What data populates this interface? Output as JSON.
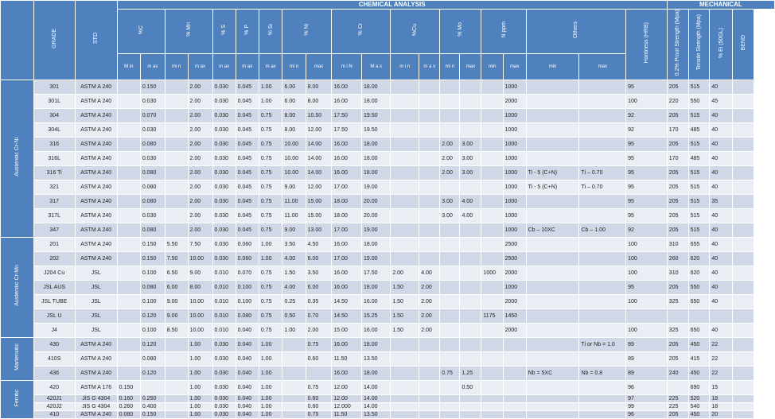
{
  "groups": {
    "chemical": "CHEMICAL ANALYSIS",
    "mechanical": "MECHANICAL"
  },
  "headers": {
    "grade": "GRADE",
    "std": "STD",
    "c": "%C",
    "mn": "% Mn",
    "s": "% S",
    "p": "% P",
    "si": "% Si",
    "ni": "% Ni",
    "cr": "% Cr",
    "cu": "%Cu",
    "mo": "% Mo",
    "n": "N ppm",
    "others": "Others",
    "hardness": "Hardness (HRB)",
    "proof": "0.2% Proof Strength (Mpa)",
    "tensile": "Tensile Strength (Mpa)",
    "elong": "% El (50GL)",
    "bend": "BEND"
  },
  "subheaders": [
    "M in",
    "m ax",
    "mi n",
    "m ax",
    "m ax",
    "m ax",
    "m ax",
    "mi n",
    "max",
    "m i N",
    "M a x",
    "m i n",
    "m a x",
    "mi n",
    "max",
    "min",
    "max",
    "min",
    "max"
  ],
  "categories": [
    {
      "label": "Austenitic Cr-Ni",
      "rows": 11
    },
    {
      "label": "Austenitic Cr-Mn",
      "rows": 7
    },
    {
      "label": "Martensitic",
      "rows": 3
    },
    {
      "label": "Ferritic",
      "rows": 4
    }
  ],
  "rows": [
    [
      "301",
      "ASTM A 240",
      "",
      "0.150",
      "",
      "2.00",
      "0.030",
      "0.045",
      "1.00",
      "6.00",
      "8.00",
      "16.00",
      "18.00",
      "",
      "",
      "",
      "",
      "",
      "1000",
      "",
      "",
      "95",
      "205",
      "515",
      "40",
      ""
    ],
    [
      "301L",
      "ASTM A 240",
      "",
      "0.030",
      "",
      "2.00",
      "0.030",
      "0.045",
      "1.00",
      "6.00",
      "8.00",
      "16.00",
      "18.00",
      "",
      "",
      "",
      "",
      "",
      "2000",
      "",
      "",
      "100",
      "220",
      "550",
      "45",
      ""
    ],
    [
      "304",
      "ASTM A 240",
      "",
      "0.070",
      "",
      "2.00",
      "0.030",
      "0.045",
      "0.75",
      "8.00",
      "10.50",
      "17.50",
      "19.50",
      "",
      "",
      "",
      "",
      "",
      "1000",
      "",
      "",
      "92",
      "205",
      "515",
      "40",
      ""
    ],
    [
      "304L",
      "ASTM A 240",
      "",
      "0.030",
      "",
      "2.00",
      "0.030",
      "0.045",
      "0.75",
      "8.00",
      "12.00",
      "17.50",
      "19.50",
      "",
      "",
      "",
      "",
      "",
      "1000",
      "",
      "",
      "92",
      "170",
      "485",
      "40",
      ""
    ],
    [
      "316",
      "ASTM A 240",
      "",
      "0.080",
      "",
      "2.00",
      "0.030",
      "0.045",
      "0.75",
      "10.00",
      "14.00",
      "16.00",
      "18.00",
      "",
      "",
      "2.00",
      "3.00",
      "",
      "1000",
      "",
      "",
      "95",
      "205",
      "515",
      "40",
      ""
    ],
    [
      "316L",
      "ASTM A 240",
      "",
      "0.030",
      "",
      "2.00",
      "0.030",
      "0.045",
      "0.75",
      "10.00",
      "14.00",
      "16.00",
      "18.00",
      "",
      "",
      "2.00",
      "3.00",
      "",
      "1000",
      "",
      "",
      "95",
      "170",
      "485",
      "40",
      ""
    ],
    [
      "316 Ti",
      "ASTM A 240",
      "",
      "0.080",
      "",
      "2.00",
      "0.030",
      "0.045",
      "0.75",
      "10.00",
      "14.00",
      "16.00",
      "18.00",
      "",
      "",
      "2.00",
      "3.00",
      "",
      "1000",
      "Ti - 5 (C+N)",
      "Ti – 0.70",
      "95",
      "205",
      "515",
      "40",
      ""
    ],
    [
      "321",
      "ASTM A 240",
      "",
      "0.080",
      "",
      "2.00",
      "0.030",
      "0.045",
      "0.75",
      "9.00",
      "12.00",
      "17.00",
      "19.00",
      "",
      "",
      "",
      "",
      "",
      "1000",
      "Ti - 5 (C+N)",
      "Ti – 0.70",
      "95",
      "205",
      "515",
      "40",
      ""
    ],
    [
      "317",
      "ASTM A 240",
      "",
      "0.080",
      "",
      "2.00",
      "0.030",
      "0.045",
      "0.75",
      "11.00",
      "15.00",
      "18.00",
      "20.00",
      "",
      "",
      "3.00",
      "4.00",
      "",
      "1000",
      "",
      "",
      "95",
      "205",
      "515",
      "35",
      ""
    ],
    [
      "317L",
      "ASTM A 240",
      "",
      "0.030",
      "",
      "2.00",
      "0.030",
      "0.045",
      "0.75",
      "11.00",
      "15.00",
      "18.00",
      "20.00",
      "",
      "",
      "3.00",
      "4.00",
      "",
      "1000",
      "",
      "",
      "95",
      "205",
      "515",
      "40",
      ""
    ],
    [
      "347",
      "ASTM A 240",
      "",
      "0.080",
      "",
      "2.00",
      "0.030",
      "0.045",
      "0.75",
      "9.00",
      "13.00",
      "17.00",
      "19.00",
      "",
      "",
      "",
      "",
      "",
      "1000",
      "Cb – 10XC",
      "Cb – 1.00",
      "92",
      "205",
      "515",
      "40",
      ""
    ],
    [
      "201",
      "ASTM A 240",
      "",
      "0.150",
      "5.50",
      "7.50",
      "0.030",
      "0.060",
      "1.00",
      "3.50",
      "4.50",
      "16.00",
      "18.00",
      "",
      "",
      "",
      "",
      "",
      "2500",
      "",
      "",
      "100",
      "310",
      "655",
      "40",
      ""
    ],
    [
      "202",
      "ASTM A 240",
      "",
      "0.150",
      "7.50",
      "10.00",
      "0.030",
      "0.060",
      "1.00",
      "4.00",
      "6.00",
      "17.00",
      "19.00",
      "",
      "",
      "",
      "",
      "",
      "2500",
      "",
      "",
      "100",
      "260",
      "620",
      "40",
      ""
    ],
    [
      "J204 Cu",
      "JSL",
      "",
      "0.100",
      "6.50",
      "9.00",
      "0.010",
      "0.070",
      "0.75",
      "1.50",
      "3.50",
      "16.00",
      "17.50",
      "2.00",
      "4.00",
      "",
      "",
      "1000",
      "2000",
      "",
      "",
      "100",
      "310",
      "620",
      "40",
      ""
    ],
    [
      "JSL AUS",
      "JSL",
      "",
      "0.080",
      "6.00",
      "8.00",
      "0.010",
      "0.100",
      "0.75",
      "4.00",
      "6.00",
      "16.00",
      "18.00",
      "1.50",
      "2.00",
      "",
      "",
      "",
      "1000",
      "",
      "",
      "95",
      "205",
      "550",
      "40",
      ""
    ],
    [
      "JSL TUBE",
      "JSL",
      "",
      "0.100",
      "9.00",
      "10.00",
      "0.010",
      "0.100",
      "0.75",
      "0.25",
      "0.35",
      "14.50",
      "16.00",
      "1.50",
      "2.00",
      "",
      "",
      "",
      "2000",
      "",
      "",
      "100",
      "325",
      "650",
      "40",
      ""
    ],
    [
      "JSL U",
      "JSL",
      "",
      "0.120",
      "9.00",
      "10.00",
      "0.010",
      "0.080",
      "0.75",
      "0.50",
      "0.70",
      "14.50",
      "15.25",
      "1.50",
      "2.00",
      "",
      "",
      "1175",
      "1450",
      "",
      "",
      "",
      "",
      "",
      "",
      ""
    ],
    [
      "J4",
      "JSL",
      "",
      "0.100",
      "8.50",
      "10.00",
      "0.010",
      "0.040",
      "0.75",
      "1.00",
      "2.00",
      "15.00",
      "16.00",
      "1.50",
      "2.00",
      "",
      "",
      "",
      "2000",
      "",
      "",
      "100",
      "325",
      "650",
      "40",
      ""
    ],
    [
      "430",
      "ASTM A 240",
      "",
      "0.120",
      "",
      "1.00",
      "0.030",
      "0.040",
      "1.00",
      "",
      "0.75",
      "16.00",
      "18.00",
      "",
      "",
      "",
      "",
      "",
      "",
      "",
      "Ti or Nb = 1.0",
      "89",
      "205",
      "450",
      "22",
      ""
    ],
    [
      "410S",
      "ASTM A 240",
      "",
      "0.080",
      "",
      "1.00",
      "0.030",
      "0.040",
      "1.00",
      "",
      "0.60",
      "11.50",
      "13.50",
      "",
      "",
      "",
      "",
      "",
      "",
      "",
      "",
      "89",
      "205",
      "415",
      "22",
      ""
    ],
    [
      "436",
      "ASTM A 240",
      "",
      "0.120",
      "",
      "1.00",
      "0.030",
      "0.040",
      "1.00",
      "",
      "",
      "16.00",
      "18.00",
      "",
      "",
      "0.75",
      "1.25",
      "",
      "",
      "Nb = 5XC",
      "Nb = 0.8",
      "89",
      "240",
      "450",
      "22",
      ""
    ],
    [
      "420",
      "ASTM A 176",
      "0.150",
      "",
      "",
      "1.00",
      "0.030",
      "0.040",
      "1.00",
      "",
      "0.75",
      "12.00",
      "14.00",
      "",
      "",
      "",
      "0.50",
      "",
      "",
      "",
      "",
      "96",
      "",
      "690",
      "15",
      ""
    ],
    [
      "420J1",
      "JIS G 4304",
      "0.160",
      "0.250",
      "",
      "1.00",
      "0.030",
      "0.040",
      "1.00",
      "",
      "0.60",
      "12.00",
      "14.00",
      "",
      "",
      "",
      "",
      "",
      "",
      "",
      "",
      "97",
      "225",
      "520",
      "18",
      ""
    ],
    [
      "420J2",
      "JIS G 4304",
      "0.260",
      "0.400",
      "",
      "1.00",
      "0.030",
      "0.040",
      "1.00",
      "",
      "0.60",
      "12.000",
      "14.00",
      "",
      "",
      "",
      "",
      "",
      "",
      "",
      "",
      "99",
      "225",
      "540",
      "18",
      ""
    ],
    [
      "410",
      "ASTM A 240",
      "0.080",
      "0.150",
      "",
      "1.00",
      "0.030",
      "0.040",
      "1.00",
      "",
      "0.75",
      "11.50",
      "13.50",
      "",
      "",
      "",
      "",
      "",
      "",
      "",
      "",
      "96",
      "205",
      "450",
      "20",
      ""
    ]
  ],
  "colors": {
    "header": "#4e81bd",
    "band_dark": "#d0d8e8",
    "band_light": "#e9edf4"
  }
}
